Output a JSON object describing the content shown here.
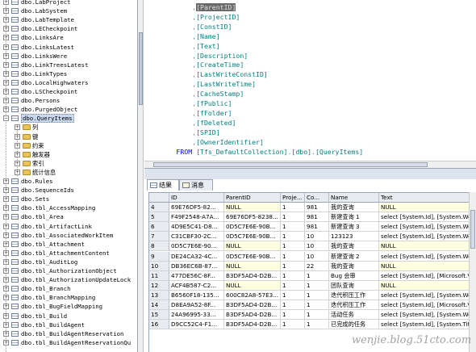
{
  "explorer": {
    "items": [
      {
        "label": "dbo.LabProject",
        "kind": "table"
      },
      {
        "label": "dbo.LabSystem",
        "kind": "table"
      },
      {
        "label": "dbo.LabTemplate",
        "kind": "table"
      },
      {
        "label": "dbo.LECheckpoint",
        "kind": "table"
      },
      {
        "label": "dbo.LinksAre",
        "kind": "table"
      },
      {
        "label": "dbo.LinksLatest",
        "kind": "table"
      },
      {
        "label": "dbo.LinksWere",
        "kind": "table"
      },
      {
        "label": "dbo.LinkTreesLatest",
        "kind": "table"
      },
      {
        "label": "dbo.LinkTypes",
        "kind": "table"
      },
      {
        "label": "dbo.LocalHighwaters",
        "kind": "table"
      },
      {
        "label": "dbo.LSCheckpoint",
        "kind": "table"
      },
      {
        "label": "dbo.Persons",
        "kind": "table"
      },
      {
        "label": "dbo.PurgedObject",
        "kind": "table"
      },
      {
        "label": "dbo.QueryItems",
        "kind": "table",
        "expanded": true,
        "selected": true
      },
      {
        "label": "列",
        "kind": "folder"
      },
      {
        "label": "键",
        "kind": "folder"
      },
      {
        "label": "约束",
        "kind": "folder"
      },
      {
        "label": "触发器",
        "kind": "folder"
      },
      {
        "label": "索引",
        "kind": "folder"
      },
      {
        "label": "统计信息",
        "kind": "folder"
      },
      {
        "label": "dbo.Rules",
        "kind": "table"
      },
      {
        "label": "dbo.SequenceIds",
        "kind": "table"
      },
      {
        "label": "dbo.Sets",
        "kind": "table"
      },
      {
        "label": "dbo.tbl_AccessMapping",
        "kind": "table"
      },
      {
        "label": "dbo.tbl_Area",
        "kind": "table"
      },
      {
        "label": "dbo.tbl_ArtifactLink",
        "kind": "table"
      },
      {
        "label": "dbo.tbl_AssociatedWorkItem",
        "kind": "table"
      },
      {
        "label": "dbo.tbl_Attachment",
        "kind": "table"
      },
      {
        "label": "dbo.tbl_AttachmentContent",
        "kind": "table"
      },
      {
        "label": "dbo.tbl_AuditLog",
        "kind": "table"
      },
      {
        "label": "dbo.tbl_AuthorizationObject",
        "kind": "table"
      },
      {
        "label": "dbo.tbl_AuthorizationUpdateLock",
        "kind": "table"
      },
      {
        "label": "dbo.tbl_Branch",
        "kind": "table"
      },
      {
        "label": "dbo.tbl_BranchMapping",
        "kind": "table"
      },
      {
        "label": "dbo.tbl_BugFieldMapping",
        "kind": "table"
      },
      {
        "label": "dbo.tbl_Build",
        "kind": "table"
      },
      {
        "label": "dbo.tbl_BuildAgent",
        "kind": "table"
      },
      {
        "label": "dbo.tbl_BuildAgentReservation",
        "kind": "table"
      },
      {
        "label": "dbo.tbl_BuildAgentReservationQu",
        "kind": "table"
      }
    ]
  },
  "editor": {
    "lines": [
      {
        "parts": [
          {
            "t": "            ,",
            "c": "punct"
          },
          {
            "t": "[ParentID]",
            "c": "hl"
          }
        ]
      },
      {
        "parts": [
          {
            "t": "            ,",
            "c": "punct"
          },
          {
            "t": "[ProjectID]",
            "c": "ident"
          }
        ]
      },
      {
        "parts": [
          {
            "t": "            ,",
            "c": "punct"
          },
          {
            "t": "[ConstID]",
            "c": "ident"
          }
        ]
      },
      {
        "parts": [
          {
            "t": "            ,",
            "c": "punct"
          },
          {
            "t": "[Name]",
            "c": "ident"
          }
        ]
      },
      {
        "parts": [
          {
            "t": "            ,",
            "c": "punct"
          },
          {
            "t": "[Text]",
            "c": "ident"
          }
        ]
      },
      {
        "parts": [
          {
            "t": "            ,",
            "c": "punct"
          },
          {
            "t": "[Description]",
            "c": "ident"
          }
        ]
      },
      {
        "parts": [
          {
            "t": "            ,",
            "c": "punct"
          },
          {
            "t": "[CreateTime]",
            "c": "ident"
          }
        ]
      },
      {
        "parts": [
          {
            "t": "            ,",
            "c": "punct"
          },
          {
            "t": "[LastWriteConstID]",
            "c": "ident"
          }
        ]
      },
      {
        "parts": [
          {
            "t": "            ,",
            "c": "punct"
          },
          {
            "t": "[LastWriteTime]",
            "c": "ident"
          }
        ]
      },
      {
        "parts": [
          {
            "t": "            ,",
            "c": "punct"
          },
          {
            "t": "[CacheStamp]",
            "c": "ident"
          }
        ]
      },
      {
        "parts": [
          {
            "t": "            ,",
            "c": "punct"
          },
          {
            "t": "[fPublic]",
            "c": "ident"
          }
        ]
      },
      {
        "parts": [
          {
            "t": "            ,",
            "c": "punct"
          },
          {
            "t": "[fFolder]",
            "c": "ident"
          }
        ]
      },
      {
        "parts": [
          {
            "t": "            ,",
            "c": "punct"
          },
          {
            "t": "[fDeleted]",
            "c": "ident"
          }
        ]
      },
      {
        "parts": [
          {
            "t": "            ,",
            "c": "punct"
          },
          {
            "t": "[SPID]",
            "c": "ident"
          }
        ]
      },
      {
        "parts": [
          {
            "t": "            ,",
            "c": "punct"
          },
          {
            "t": "[OwnerIdentifier]",
            "c": "ident"
          }
        ]
      },
      {
        "parts": [
          {
            "t": "        FROM ",
            "c": "kw"
          },
          {
            "t": "[Tfs_DefaultCollection]",
            "c": "ident"
          },
          {
            "t": ".",
            "c": "punct"
          },
          {
            "t": "[dbo]",
            "c": "ident"
          },
          {
            "t": ".",
            "c": "punct"
          },
          {
            "t": "[QueryItems]",
            "c": "ident"
          }
        ]
      }
    ]
  },
  "tabs": {
    "results_label": "结果",
    "messages_label": "消息"
  },
  "grid": {
    "columns": [
      "ID",
      "ParentID",
      "Proje...",
      "Co...",
      "Name",
      "Text"
    ],
    "rows": [
      {
        "num": "4",
        "cells": [
          "69E76DF5-82...",
          "NULL",
          "1",
          "981",
          "我的查询",
          "NULL"
        ]
      },
      {
        "num": "5",
        "cells": [
          "F49F2548-A7A...",
          "69E76DF5-8238...",
          "1",
          "981",
          "新建查询 1",
          "select [System.Id], [System.Wo"
        ]
      },
      {
        "num": "6",
        "cells": [
          "4D9E5C41-D8...",
          "0D5C7E6E-90B...",
          "1",
          "981",
          "新建查询 3",
          "select [System.Id], [System.Wo"
        ]
      },
      {
        "num": "7",
        "cells": [
          "C31CBF30-2C...",
          "0D5C7E6E-90B...",
          "1",
          "10",
          "123123",
          "select [System.Id], [System.Wo"
        ]
      },
      {
        "num": "8",
        "cells": [
          "0D5C7E6E-90...",
          "NULL",
          "1",
          "10",
          "我的查询",
          "NULL"
        ]
      },
      {
        "num": "9",
        "cells": [
          "DE24CA32-4C...",
          "0D5C7E6E-90B...",
          "1",
          "10",
          "新建查询 2",
          "select [System.Id], [System.Wo"
        ]
      },
      {
        "num": "10",
        "cells": [
          "DB36EC6B-87...",
          "NULL",
          "1",
          "22",
          "我的查询",
          "NULL"
        ]
      },
      {
        "num": "11",
        "cells": [
          "477DE56C-8F...",
          "B3DF5AD4-D2B...",
          "1",
          "1",
          "Bug 会审",
          "select [System.Id], [Microsoft.V"
        ]
      },
      {
        "num": "12",
        "cells": [
          "ACF4B587-C2...",
          "NULL",
          "1",
          "1",
          "团队查询",
          "NULL"
        ]
      },
      {
        "num": "13",
        "cells": [
          "B6560F18-135...",
          "600C82A8-57E3...",
          "1",
          "1",
          "迭代积压工作",
          "select [System.Id], [System.Wo"
        ]
      },
      {
        "num": "14",
        "cells": [
          "D8EA9A52-8F...",
          "B3DF5AD4-D2B...",
          "1",
          "1",
          "迭代积压工作",
          "select [System.Id], [Microsoft.V"
        ]
      },
      {
        "num": "15",
        "cells": [
          "24A96995-33...",
          "B3DF5AD4-D2B...",
          "1",
          "1",
          "活动任务",
          "select [System.Id], [System.Wo"
        ]
      },
      {
        "num": "16",
        "cells": [
          "D9CC52C4-F1...",
          "B3DF5AD4-D2B...",
          "1",
          "1",
          "已完成的任务",
          "select [System.Id], [System.Tit"
        ]
      }
    ]
  },
  "watermark": "wenjie.blog.51cto.com"
}
